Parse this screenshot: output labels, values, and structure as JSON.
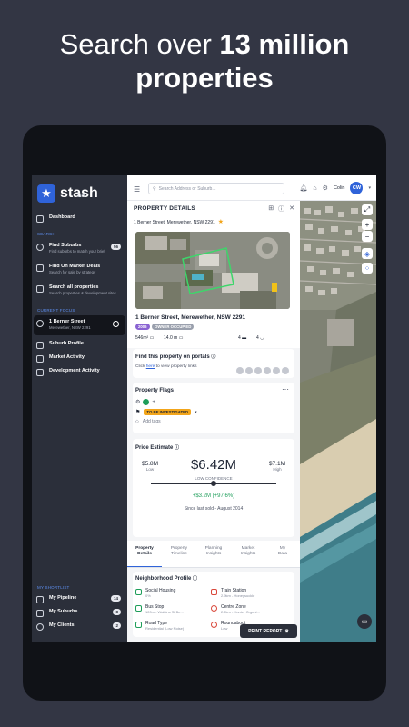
{
  "headline": {
    "line1": "Search over",
    "highlight": "13 million",
    "line2": "properties"
  },
  "sidebar": {
    "logo_text": "stash",
    "logo_sub": "ba",
    "dashboard": "Dashboard",
    "search_section": "SEARCH",
    "items": [
      {
        "title": "Find Suburbs",
        "sub": "Find suburbs to match your brief",
        "badge": "56"
      },
      {
        "title": "Find On Market Deals",
        "sub": "Search for sale by strategy"
      },
      {
        "title": "Search all properties",
        "sub": "Search properties & development sites"
      }
    ],
    "focus_section": "CURRENT FOCUS",
    "focus": {
      "title": "1 Berner Street",
      "sub": "Merewether, NSW 2291"
    },
    "focus_items": [
      "Suburb Profile",
      "Market Activity",
      "Development Activity"
    ],
    "shortlist_section": "MY SHORTLIST",
    "shortlist": [
      {
        "label": "My Pipeline",
        "badge": "14"
      },
      {
        "label": "My Suburbs",
        "badge": "8"
      },
      {
        "label": "My Clients",
        "badge": "2"
      }
    ]
  },
  "topbar": {
    "search_placeholder": "Search Address or Suburb...",
    "user_name": "Colin",
    "avatar": "CW"
  },
  "property": {
    "header": "PROPERTY DETAILS",
    "address_line": "1 Berner Street, Merewether, NSW 2291",
    "address": "1 Berner Street, Merewether, NSW 2291",
    "year_tag": "2006",
    "occupancy_tag": "OWNER OCCUPIED",
    "land_area": "546m²",
    "frontage": "14.0 m",
    "beds": "4",
    "baths": "4"
  },
  "portals": {
    "title": "Find this property on portals",
    "text_before": "Click ",
    "link": "here",
    "text_after": " to view property links"
  },
  "flags": {
    "title": "Property Flags",
    "flag_label": "TO BE INVESTIGATED",
    "add_tags": "Add tags"
  },
  "estimate": {
    "title": "Price Estimate",
    "low": "$5.8M",
    "low_label": "Low",
    "mid": "$6.42M",
    "high": "$7.1M",
    "high_label": "High",
    "confidence": "LOW CONFIDENCE",
    "change": "+$3.2M (+97.6%)",
    "since": "Since last sold - August 2014"
  },
  "tabs": [
    {
      "l1": "Property",
      "l2": "Details"
    },
    {
      "l1": "Property",
      "l2": "Timeline"
    },
    {
      "l1": "Planning",
      "l2": "Insights"
    },
    {
      "l1": "Market",
      "l2": "Insights"
    },
    {
      "l1": "My",
      "l2": "Data"
    }
  ],
  "neighborhood": {
    "title": "Neighborhood Profile",
    "items": [
      {
        "title": "Social Housing",
        "sub": "0%"
      },
      {
        "title": "Train Station",
        "sub": "2.9km - Honeysuckle"
      },
      {
        "title": "Bus Stop",
        "sub": "120m - Watkins St Be..."
      },
      {
        "title": "Centre Zone",
        "sub": "2.2km - Hunter Organi..."
      },
      {
        "title": "Road Type",
        "sub": "Residential (Low Noise)"
      },
      {
        "title": "Roundabout",
        "sub": "Low"
      }
    ]
  },
  "print_button": "PRINT REPORT",
  "colors": {
    "accent": "#2f63d9",
    "sidebar": "#2b2f3a",
    "flag": "#f2a51a",
    "positive": "#1e9e5a"
  }
}
